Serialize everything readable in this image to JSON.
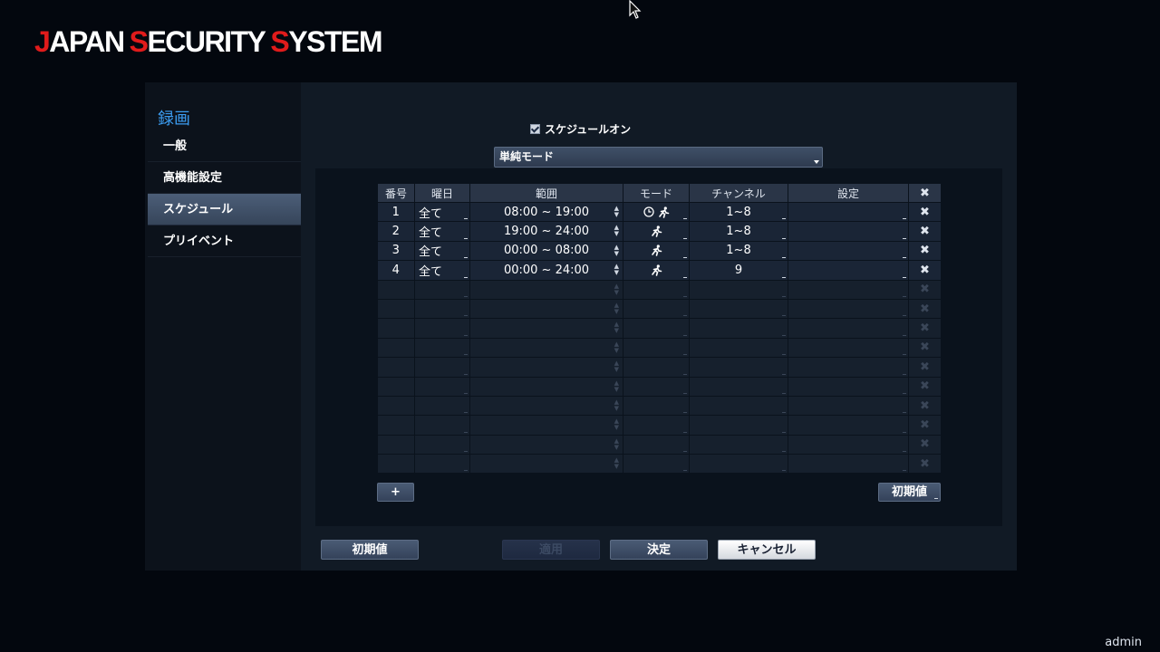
{
  "logo": {
    "j": "J",
    "apan": "APAN",
    "s1": "S",
    "ecurity": "ECURITY",
    "s2": "S",
    "ystem": "YSTEM"
  },
  "sidebar": {
    "title": "録画",
    "items": [
      {
        "label": "一般",
        "active": false
      },
      {
        "label": "高機能設定",
        "active": false
      },
      {
        "label": "スケジュール",
        "active": true
      },
      {
        "label": "プリイベント",
        "active": false
      }
    ]
  },
  "schedule_on": {
    "label": "スケジュールオン",
    "checked": true
  },
  "mode_select": {
    "value": "単純モード"
  },
  "table": {
    "headers": [
      "番号",
      "曜日",
      "範囲",
      "モード",
      "チャンネル",
      "設定"
    ],
    "rows": [
      {
        "num": "1",
        "day": "全て",
        "range": "08:00 ~ 19:00",
        "mode": [
          "clock-icon",
          "run-icon"
        ],
        "channel": "1~8",
        "setting": ""
      },
      {
        "num": "2",
        "day": "全て",
        "range": "19:00 ~ 24:00",
        "mode": [
          "run-icon"
        ],
        "channel": "1~8",
        "setting": ""
      },
      {
        "num": "3",
        "day": "全て",
        "range": "00:00 ~ 08:00",
        "mode": [
          "run-icon"
        ],
        "channel": "1~8",
        "setting": ""
      },
      {
        "num": "4",
        "day": "全て",
        "range": "00:00 ~ 24:00",
        "mode": [
          "run-icon"
        ],
        "channel": "9",
        "setting": ""
      }
    ],
    "empty_rows": 10,
    "delete_glyph": "✖"
  },
  "buttons": {
    "add": "+",
    "table_default": "初期値",
    "default": "初期値",
    "apply": "適用",
    "ok": "決定",
    "cancel": "キャンセル"
  },
  "user": "admin",
  "colors": {
    "accent": "#3b9cf0",
    "logo_red": "#e01b1b"
  }
}
